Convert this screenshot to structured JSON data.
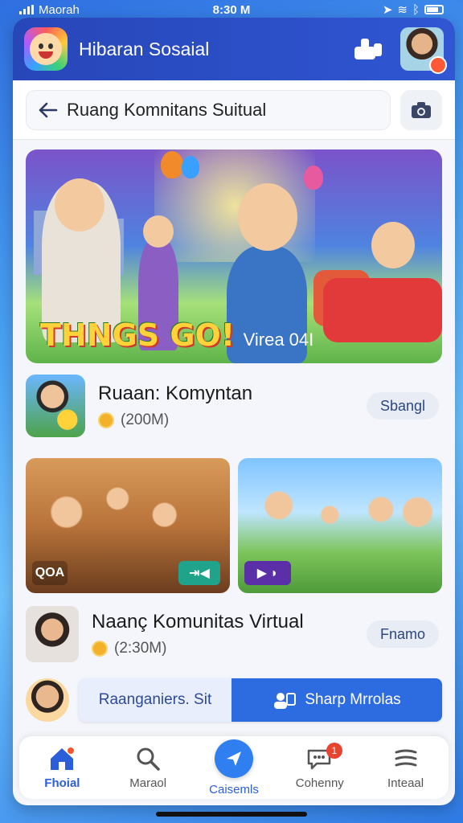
{
  "status_bar": {
    "carrier": "Maorah",
    "time": "8:30 M"
  },
  "header": {
    "app_title": "Hibaran Sosaial",
    "icons": [
      "app-logo",
      "share-icon",
      "profile-avatar"
    ]
  },
  "subheader": {
    "title": "Ruang Komnitans Suitual",
    "icons": [
      "back-arrow-icon",
      "camera-icon"
    ]
  },
  "banner": {
    "headline": "THNGS GO!",
    "subtitle": "Virea 04I"
  },
  "rows": [
    {
      "title": "Ruaan: Komyntan",
      "subtitle": "(200M)",
      "button": "Sbangl"
    },
    {
      "title": "Naanç Komunitas Virtual",
      "subtitle": "(2:30M)",
      "button": "Fnamo"
    }
  ],
  "media": [
    {
      "badge": "QOA"
    },
    {
      "badge": ""
    }
  ],
  "action_row": {
    "left_label": "Raanganiers. Sit",
    "right_label": "Sharp Mrrolas"
  },
  "bottom_nav": {
    "items": [
      {
        "label": "Fhoial",
        "icon": "home-icon",
        "active": true
      },
      {
        "label": "Maraol",
        "icon": "search-icon",
        "active": false
      },
      {
        "label": "Caisemls",
        "icon": "send-icon",
        "active": false
      },
      {
        "label": "Cohenny",
        "icon": "chat-icon",
        "active": false,
        "badge": "1"
      },
      {
        "label": "Inteaal",
        "icon": "menu-icon",
        "active": false
      }
    ]
  },
  "colors": {
    "header_bg": "#2746b8",
    "accent": "#2d6be0",
    "badge": "#e8442f"
  }
}
